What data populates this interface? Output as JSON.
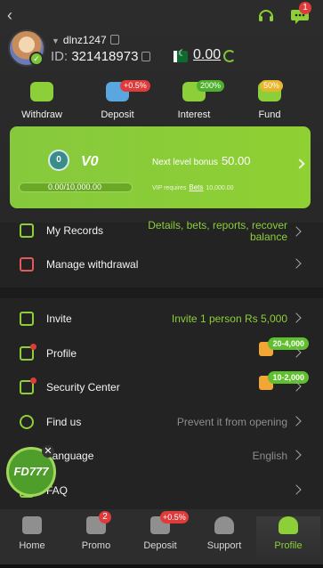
{
  "header": {
    "chat_badge": "1"
  },
  "profile": {
    "username": "dlnz1247",
    "id_label": "ID:",
    "id_value": "321418973",
    "balance": "0.00"
  },
  "quick_actions": [
    {
      "label": "Withdraw",
      "tag": ""
    },
    {
      "label": "Deposit",
      "tag": "+0.5%"
    },
    {
      "label": "Interest",
      "tag": "200%"
    },
    {
      "label": "Fund",
      "tag": "50%"
    }
  ],
  "vip": {
    "medal": "0",
    "level": "V0",
    "next_label": "Next level bonus",
    "next_value": "50.00",
    "progress_text": "0.00/10,000.00",
    "progress_fraction": 0,
    "requires_prefix": "VIP requires",
    "requires_link": "Bets",
    "requires_value": "10,000.00"
  },
  "menu_top": [
    {
      "title": "My Records",
      "value_line1": "Details, bets, reports, recover",
      "value_line2": "balance"
    },
    {
      "title": "Manage withdrawal",
      "value_line1": "",
      "value_line2": ""
    }
  ],
  "menu_bottom": [
    {
      "title": "Invite",
      "value": "Invite 1 person Rs 5,000",
      "badge": ""
    },
    {
      "title": "Profile",
      "value": "",
      "badge": "20-4,000"
    },
    {
      "title": "Security Center",
      "value": "",
      "badge": "10-2,000"
    },
    {
      "title": "Find us",
      "value": "Prevent it from opening",
      "badge": ""
    },
    {
      "title": "Language",
      "value": "English",
      "badge": ""
    },
    {
      "title": "FAQ",
      "value": "",
      "badge": ""
    }
  ],
  "fab": {
    "label": "FD777"
  },
  "tabbar": [
    {
      "label": "Home",
      "badge": ""
    },
    {
      "label": "Promo",
      "badge": "2"
    },
    {
      "label": "Deposit",
      "badge": "+0.5%"
    },
    {
      "label": "Support",
      "badge": ""
    },
    {
      "label": "Profile",
      "badge": ""
    }
  ],
  "colors": {
    "accent": "#8ccf39",
    "background": "#232323",
    "badge_red": "#e03b3b"
  }
}
